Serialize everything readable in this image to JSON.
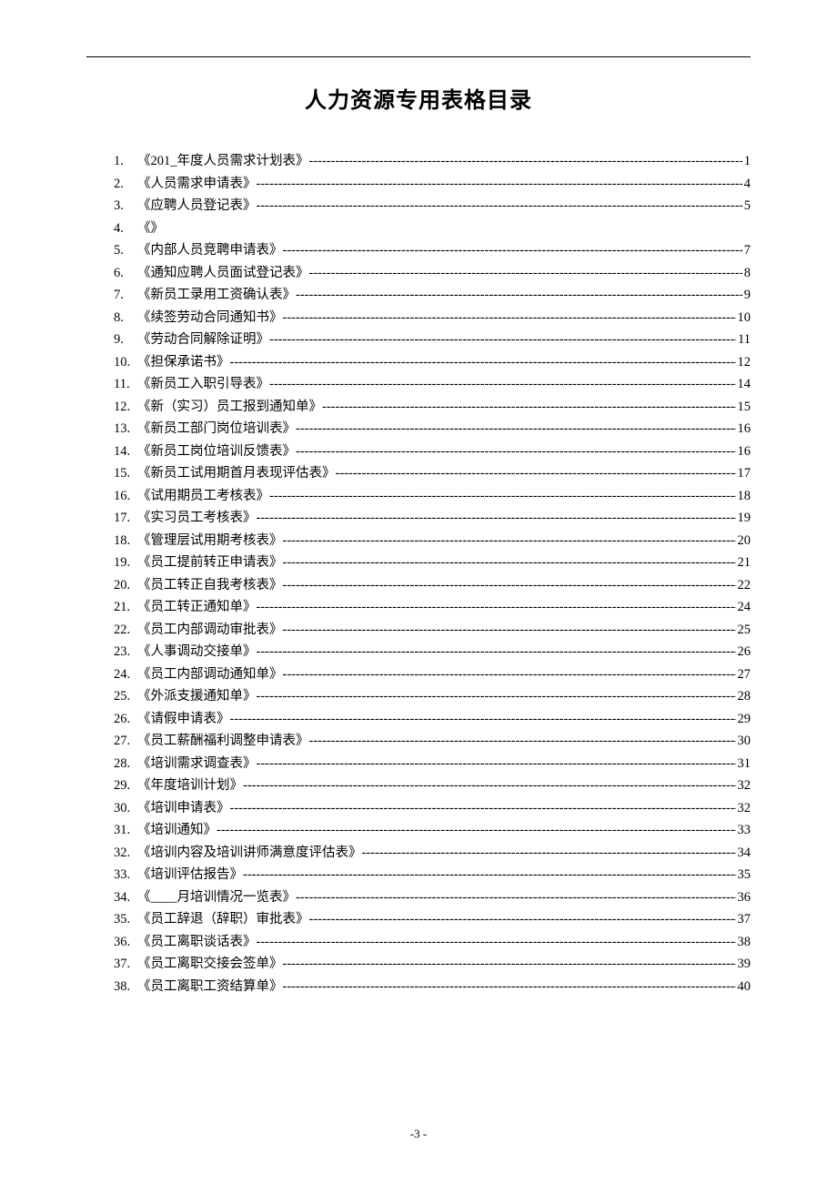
{
  "title": "人力资源专用表格目录",
  "footer_page": "-3 -",
  "leader_char": "-",
  "toc": [
    {
      "num": "1.",
      "title": "《201_年度人员需求计划表》",
      "page": "1"
    },
    {
      "num": "2.",
      "title": "《人员需求申请表》",
      "page": "4"
    },
    {
      "num": "3.",
      "title": "《应聘人员登记表》",
      "page": "5"
    },
    {
      "num": "4.",
      "title": "《》",
      "page": ""
    },
    {
      "num": "5.",
      "title": "《内部人员竞聘申请表》",
      "page": "7"
    },
    {
      "num": "6.",
      "title": "《通知应聘人员面试登记表》",
      "page": "8"
    },
    {
      "num": "7.",
      "title": "《新员工录用工资确认表》",
      "page": "9"
    },
    {
      "num": "8.",
      "title": "《续签劳动合同通知书》",
      "page": "10"
    },
    {
      "num": "9.",
      "title": "《劳动合同解除证明》",
      "page": "11"
    },
    {
      "num": "10.",
      "title": "《担保承诺书》",
      "page": "12"
    },
    {
      "num": "11.",
      "title": "《新员工入职引导表》",
      "page": "14"
    },
    {
      "num": "12.",
      "title": "《新（实习）员工报到通知单》",
      "page": "15"
    },
    {
      "num": "13.",
      "title": "《新员工部门岗位培训表》",
      "page": "16"
    },
    {
      "num": "14.",
      "title": "《新员工岗位培训反馈表》",
      "page": "16"
    },
    {
      "num": "15.",
      "title": "《新员工试用期首月表现评估表》",
      "page": "17"
    },
    {
      "num": "16.",
      "title": "《试用期员工考核表》",
      "page": "18"
    },
    {
      "num": "17.",
      "title": "《实习员工考核表》",
      "page": "19"
    },
    {
      "num": "18.",
      "title": "《管理层试用期考核表》",
      "page": "20"
    },
    {
      "num": "19.",
      "title": "《员工提前转正申请表》",
      "page": "21"
    },
    {
      "num": "20.",
      "title": "《员工转正自我考核表》",
      "page": "22"
    },
    {
      "num": "21.",
      "title": "《员工转正通知单》",
      "page": "24"
    },
    {
      "num": "22.",
      "title": "《员工内部调动审批表》",
      "page": "25"
    },
    {
      "num": "23.",
      "title": "《人事调动交接单》",
      "page": "26"
    },
    {
      "num": "24.",
      "title": "《员工内部调动通知单》",
      "page": "27"
    },
    {
      "num": "25.",
      "title": "《外派支援通知单》",
      "page": "28"
    },
    {
      "num": "26.",
      "title": "《请假申请表》",
      "page": "29"
    },
    {
      "num": "27.",
      "title": "《员工薪酬福利调整申请表》",
      "page": "30"
    },
    {
      "num": "28.",
      "title": "《培训需求调查表》",
      "page": "31"
    },
    {
      "num": "29.",
      "title": "《年度培训计划》",
      "page": "32"
    },
    {
      "num": "30.",
      "title": "《培训申请表》",
      "page": "32"
    },
    {
      "num": "31.",
      "title": "《培训通知》",
      "page": "33"
    },
    {
      "num": "32.",
      "title": "《培训内容及培训讲师满意度评估表》",
      "page": "34"
    },
    {
      "num": "33.",
      "title": "《培训评估报告》",
      "page": "35"
    },
    {
      "num": "34.",
      "title": "《____月培训情况一览表》",
      "page": "36"
    },
    {
      "num": "35.",
      "title": "《员工辞退（辞职）审批表》",
      "page": "37"
    },
    {
      "num": "36.",
      "title": "《员工离职谈话表》",
      "page": "38"
    },
    {
      "num": "37.",
      "title": "《员工离职交接会签单》",
      "page": "39"
    },
    {
      "num": "38.",
      "title": "《员工离职工资结算单》",
      "page": "40"
    }
  ]
}
